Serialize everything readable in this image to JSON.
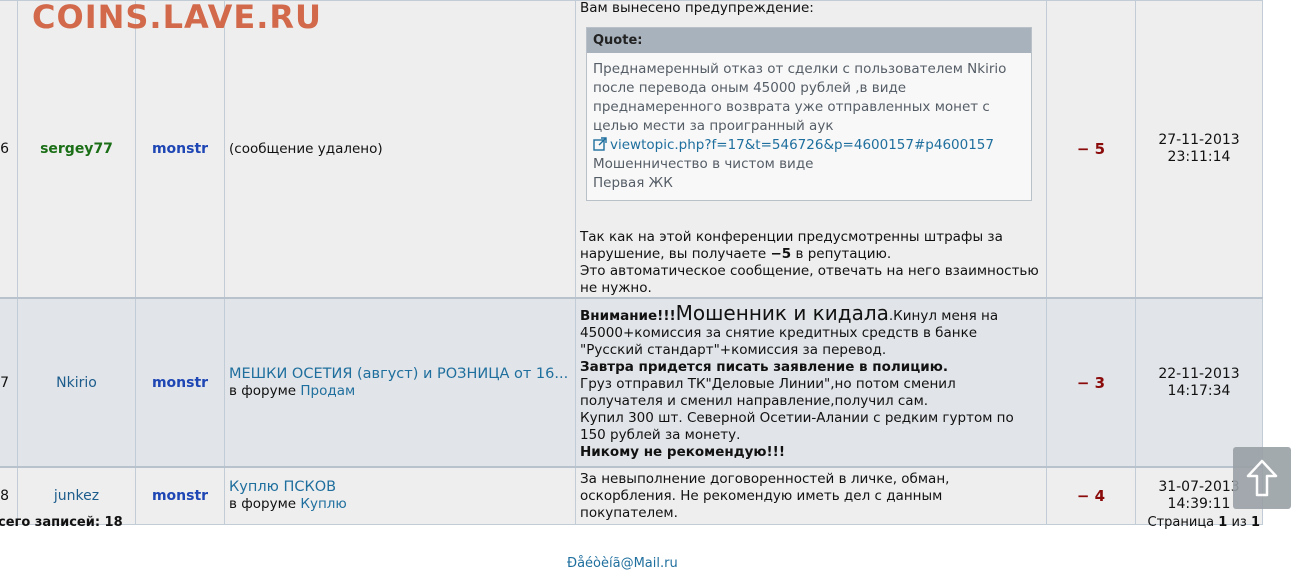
{
  "watermark": "COINS.LAVE.RU",
  "rows": [
    {
      "num": "6",
      "from": "sergey77",
      "to": "monstr",
      "topic": "(сообщение удалено)",
      "message": {
        "intro": "Вам вынесено предупреждение:",
        "quote_label": "Quote:",
        "quote_line1": "Преднамеренный отказ от сделки с пользователем Nkirio после перевода оным 45000 рублей ,в виде преднамеренного возврата уже отправленных монет с целью мести за проигранный аук",
        "quote_link": "viewtopic.php?f=17&t=546726&p=4600157#p4600157",
        "quote_line2": "Мошенничество в чистом виде",
        "quote_line3": "Первая ЖК",
        "outro_a": "Так как на этой конференции предусмотренны штрафы за нарушение, вы получаете ",
        "outro_pts": "−5",
        "outro_b": " в репутацию.",
        "outro_c": "Это автоматическое сообщение, отвечать на него взаимностью не нужно."
      },
      "points": "− 5",
      "date": "27-11-2013",
      "time": "23:11:14"
    },
    {
      "num": "7",
      "from": "Nkirio",
      "to": "monstr",
      "topic": "МЕШКИ ОСЕТИЯ (август) и РОЗНИЦА от 16...",
      "forum_prefix": "в форуме ",
      "forum": "Продам",
      "message": {
        "warn": "Внимание!!!",
        "big": "Мошенник и кидала",
        "p1": ".Кинул меня на 45000+комиссия за снятие кредитных средств в банке \"Русский стандарт\"+комиссия за перевод.",
        "p2": "Завтра придется писать заявление в полицию.",
        "p3": "Груз отправил ТК\"Деловые Линии\",но потом сменил получателя и сменил направление,получил сам.",
        "p4": "Купил 300 шт. Северной Осетии-Алании с редким гуртом по 150 рублей за монету.",
        "p5": "Никому не рекомендую!!!"
      },
      "points": "− 3",
      "date": "22-11-2013",
      "time": "14:17:34"
    },
    {
      "num": "8",
      "from": "junkez",
      "to": "monstr",
      "topic": "Куплю ПСКОВ",
      "forum_prefix": "в форуме ",
      "forum": "Куплю",
      "message": {
        "p1": "За невыполнение договоренностей в личке, обман, оскорбления. Не рекомендую иметь дел с данным покупателем."
      },
      "points": "− 4",
      "date": "31-07-2013",
      "time": "14:39:11"
    }
  ],
  "footer": {
    "total_label": "сего записей: ",
    "total_value": "18",
    "page_label": "Страница ",
    "page_current": "1",
    "page_of": " из ",
    "page_total": "1",
    "mail": "Ðåéòèíã@Mail.ru"
  },
  "icons": {
    "scroll_top": "arrow-up-icon",
    "external_link": "external-link-icon"
  }
}
